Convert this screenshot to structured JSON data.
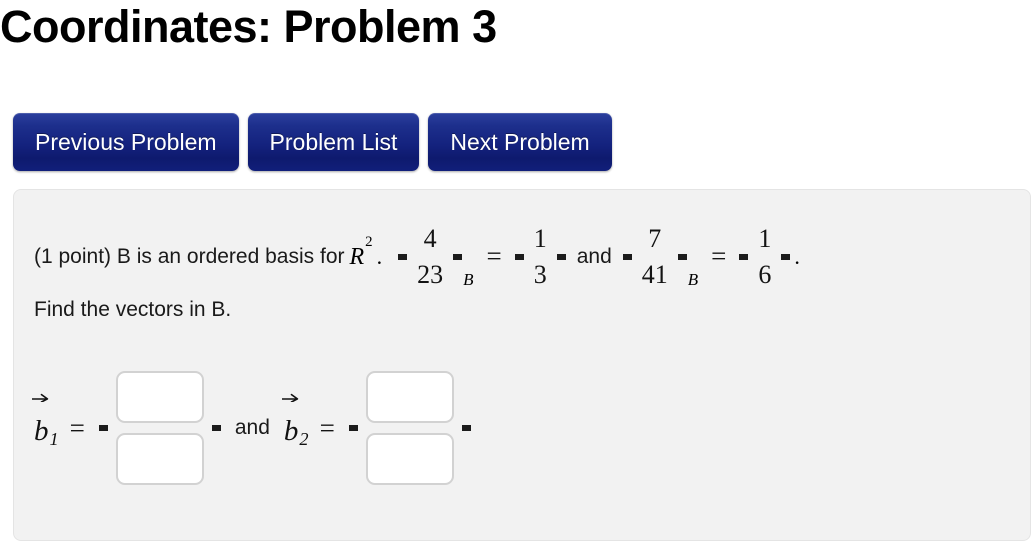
{
  "page": {
    "title": "Coordinates: Problem 3"
  },
  "nav": {
    "buttons": [
      {
        "label": "Previous Problem",
        "name": "previous-problem-button"
      },
      {
        "label": "Problem List",
        "name": "problem-list-button"
      },
      {
        "label": "Next Problem",
        "name": "next-problem-button"
      }
    ]
  },
  "problem": {
    "points_text": "(1 point) B is an ordered basis for",
    "space_symbol": "R",
    "space_exponent": "2",
    "trailing_period": ".",
    "conjunction": "and",
    "final_period": ".",
    "equation1": {
      "lhs": {
        "top": "4",
        "bottom": "23",
        "subscript": "B"
      },
      "equals": "=",
      "rhs": {
        "top": "1",
        "bottom": "3"
      }
    },
    "equation2": {
      "lhs": {
        "top": "7",
        "bottom": "41",
        "subscript": "B"
      },
      "equals": "=",
      "rhs": {
        "top": "1",
        "bottom": "6"
      }
    },
    "instruction": "Find the vectors in B."
  },
  "answer": {
    "vector1": {
      "symbol": "b",
      "index": "1",
      "equals": "=",
      "fields": [
        {
          "value": "",
          "placeholder": ""
        },
        {
          "value": "",
          "placeholder": ""
        }
      ]
    },
    "conjunction": "and",
    "vector2": {
      "symbol": "b",
      "index": "2",
      "equals": "=",
      "fields": [
        {
          "value": "",
          "placeholder": ""
        },
        {
          "value": "",
          "placeholder": ""
        }
      ]
    }
  },
  "colors": {
    "button_top": "#2b3f9e",
    "button_bottom": "#0e1a6e",
    "panel_bg": "#f2f2f2",
    "panel_border": "#e4e4e4",
    "input_border": "#d2d2d2",
    "text": "#1a1a1a"
  }
}
